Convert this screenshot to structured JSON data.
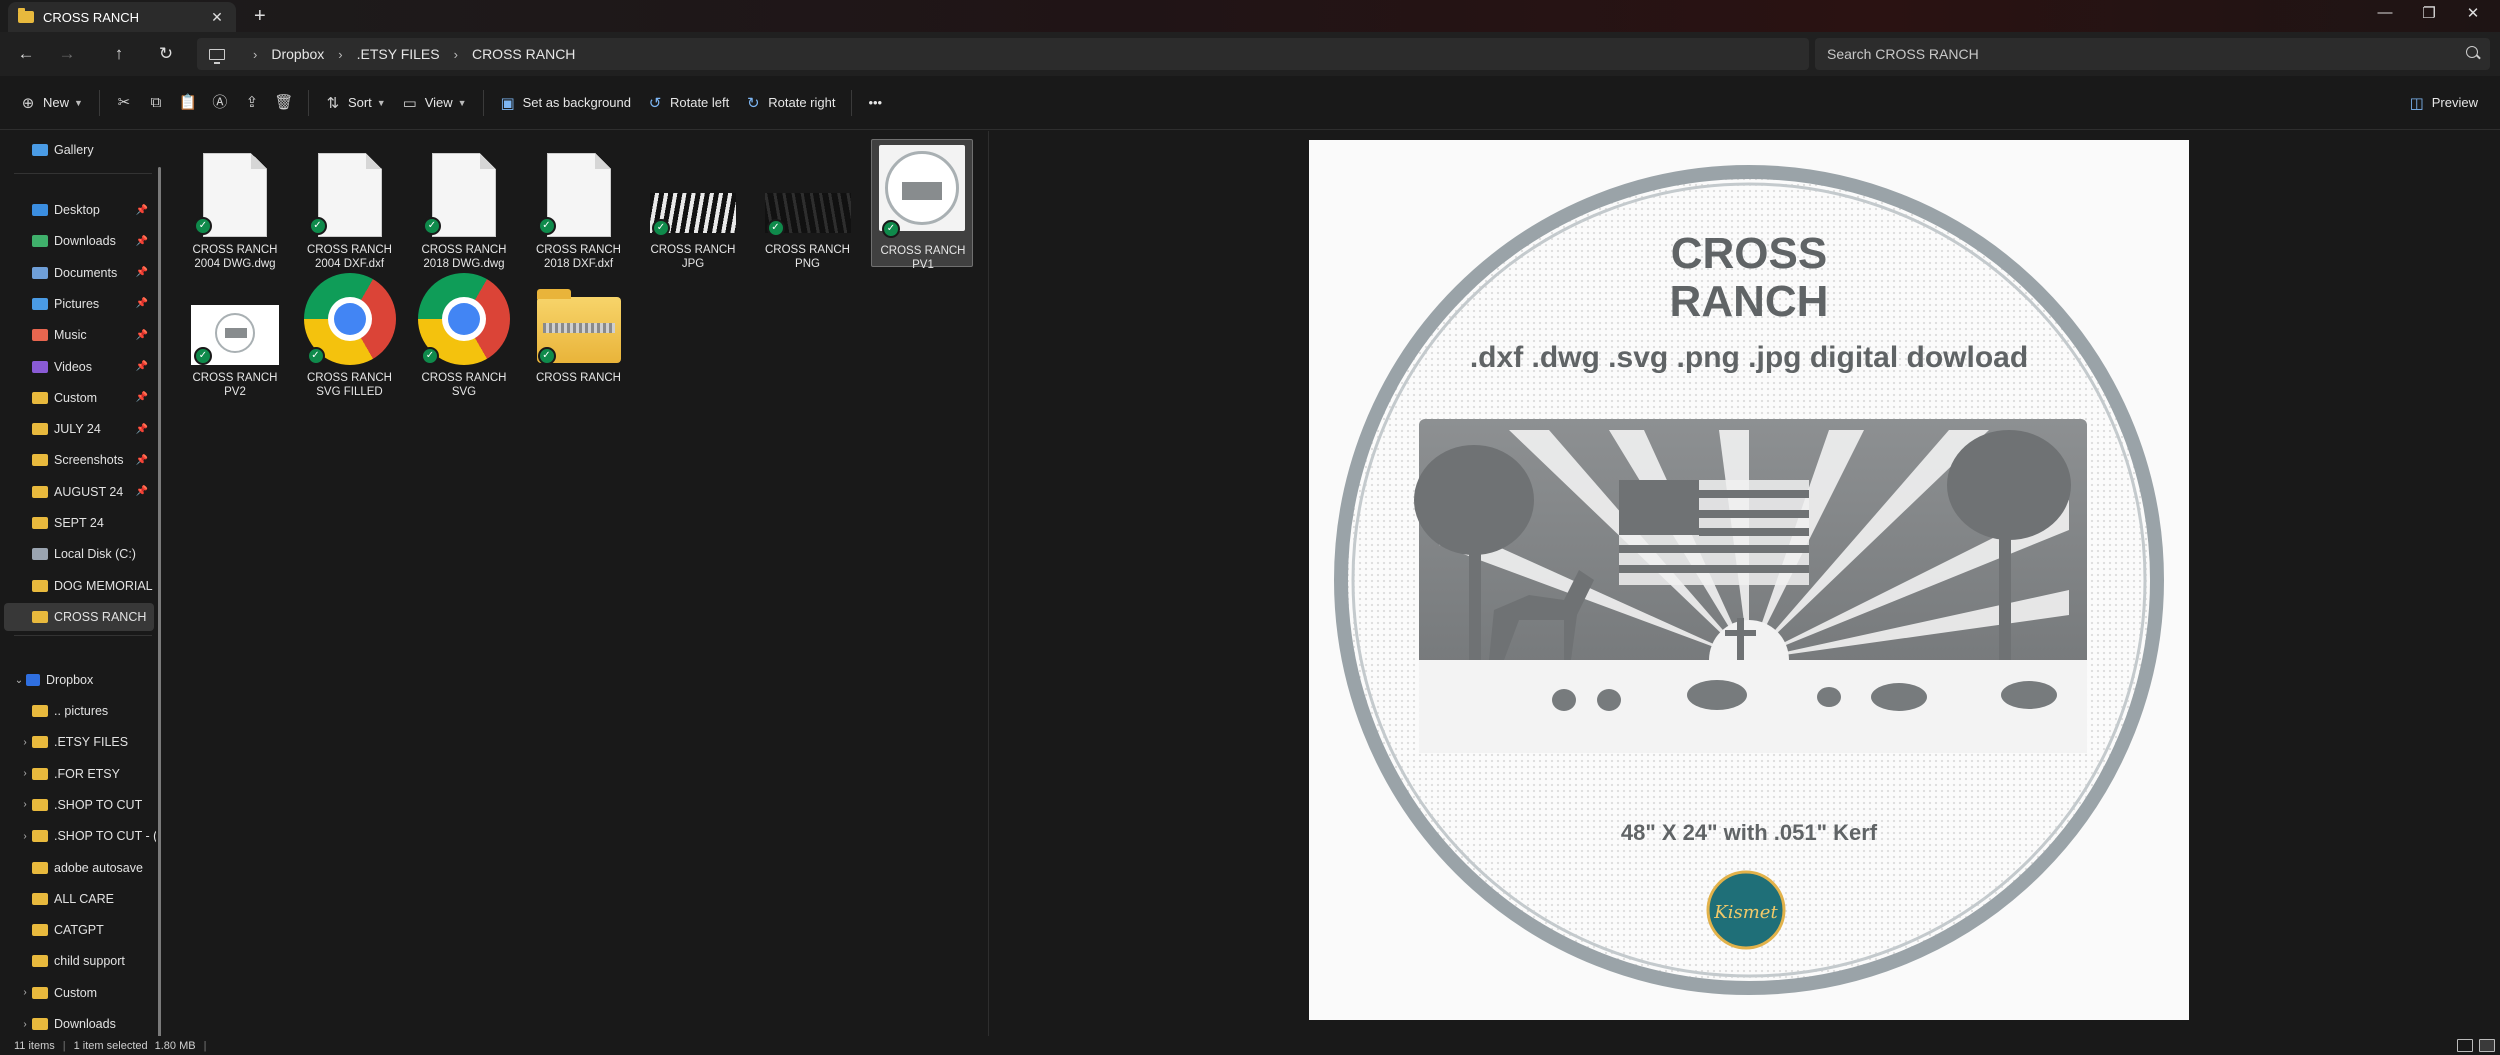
{
  "window": {
    "tab_title": "CROSS RANCH",
    "tab_close": "✕",
    "new_tab": "+",
    "minimize": "—",
    "maximize": "❐",
    "close": "✕"
  },
  "nav": {
    "back": "←",
    "forward": "→",
    "up": "↑",
    "refresh": "↻",
    "breadcrumbs": [
      "Dropbox",
      ".ETSY FILES",
      "CROSS RANCH"
    ],
    "search_placeholder": "Search CROSS RANCH"
  },
  "toolbar": {
    "new_label": "New",
    "sort_label": "Sort",
    "view_label": "View",
    "set_background_label": "Set as background",
    "rotate_left_label": "Rotate left",
    "rotate_right_label": "Rotate right",
    "more_label": "•••",
    "preview_label": "Preview"
  },
  "sidebar": {
    "gallery": "Gallery",
    "quick_access": [
      {
        "label": "Desktop",
        "color": "#3b8ee0",
        "pinned": true
      },
      {
        "label": "Downloads",
        "color": "#3fb06b",
        "pinned": true
      },
      {
        "label": "Documents",
        "color": "#6f9fd8",
        "pinned": true
      },
      {
        "label": "Pictures",
        "color": "#4a9be5",
        "pinned": true
      },
      {
        "label": "Music",
        "color": "#e8664f",
        "pinned": true
      },
      {
        "label": "Videos",
        "color": "#8a5bd6",
        "pinned": true
      },
      {
        "label": "Custom",
        "color": "#e8b93d",
        "pinned": true
      },
      {
        "label": "JULY 24",
        "color": "#e8b93d",
        "pinned": true
      },
      {
        "label": "Screenshots",
        "color": "#e8b93d",
        "pinned": true
      },
      {
        "label": "AUGUST 24",
        "color": "#e8b93d",
        "pinned": true
      },
      {
        "label": "SEPT 24",
        "color": "#e8b93d",
        "pinned": false
      },
      {
        "label": "Local Disk (C:)",
        "color": "#9aa4b0",
        "pinned": false
      },
      {
        "label": "DOG MEMORIAL F",
        "color": "#e8b93d",
        "pinned": false
      },
      {
        "label": "CROSS RANCH",
        "color": "#e8b93d",
        "pinned": false,
        "selected": true
      }
    ],
    "dropbox_label": "Dropbox",
    "dropbox_items": [
      {
        "label": ".. pictures",
        "expandable": false
      },
      {
        "label": ".ETSY FILES",
        "expandable": true
      },
      {
        "label": ".FOR ETSY",
        "expandable": true
      },
      {
        "label": ".SHOP TO CUT",
        "expandable": true
      },
      {
        "label": ".SHOP TO CUT - (",
        "expandable": true
      },
      {
        "label": "adobe autosave",
        "expandable": false
      },
      {
        "label": "ALL CARE",
        "expandable": false
      },
      {
        "label": "CATGPT",
        "expandable": false
      },
      {
        "label": "child support",
        "expandable": false
      },
      {
        "label": "Custom",
        "expandable": true
      },
      {
        "label": "Downloads",
        "expandable": true
      }
    ]
  },
  "files": [
    {
      "name": "CROSS RANCH 2004 DWG.dwg",
      "line1": "CROSS RANCH",
      "line2": "2004 DWG.dwg",
      "kind": "doc"
    },
    {
      "name": "CROSS RANCH 2004 DXF.dxf",
      "line1": "CROSS RANCH",
      "line2": "2004 DXF.dxf",
      "kind": "doc"
    },
    {
      "name": "CROSS RANCH 2018 DWG.dwg",
      "line1": "CROSS RANCH",
      "line2": "2018 DWG.dwg",
      "kind": "doc"
    },
    {
      "name": "CROSS RANCH 2018 DXF.dxf",
      "line1": "CROSS RANCH",
      "line2": "2018 DXF.dxf",
      "kind": "doc"
    },
    {
      "name": "CROSS RANCH JPG",
      "line1": "CROSS RANCH",
      "line2": "JPG",
      "kind": "jpg"
    },
    {
      "name": "CROSS RANCH PNG",
      "line1": "CROSS RANCH",
      "line2": "PNG",
      "kind": "png"
    },
    {
      "name": "CROSS RANCH PV1",
      "line1": "CROSS RANCH",
      "line2": "PV1",
      "kind": "pv1",
      "selected": true
    },
    {
      "name": "CROSS RANCH PV2",
      "line1": "CROSS RANCH",
      "line2": "PV2",
      "kind": "pv2"
    },
    {
      "name": "CROSS RANCH SVG FILLED",
      "line1": "CROSS RANCH",
      "line2": "SVG FILLED",
      "kind": "chrome"
    },
    {
      "name": "CROSS RANCH SVG",
      "line1": "CROSS RANCH",
      "line2": "SVG",
      "kind": "chrome"
    },
    {
      "name": "CROSS RANCH",
      "line1": "CROSS RANCH",
      "line2": "",
      "kind": "zip"
    }
  ],
  "preview": {
    "title_line1": "CROSS",
    "title_line2": "RANCH",
    "formats": ".dxf .dwg .svg .png .jpg digital dowload",
    "dimensions": "48\" X 24\" with .051\" Kerf",
    "logo_text": "Kismet"
  },
  "status": {
    "item_count": "11 items",
    "selection": "1 item selected",
    "size": "1.80 MB"
  }
}
